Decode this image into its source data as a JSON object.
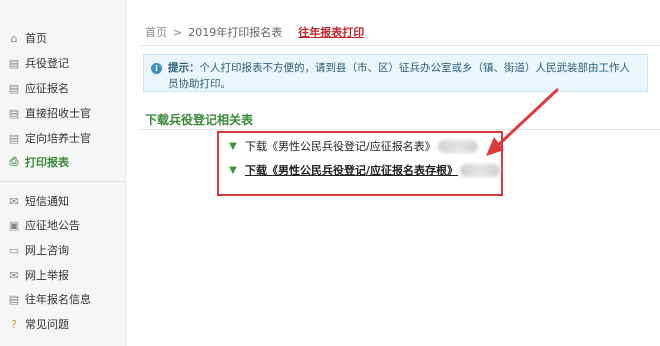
{
  "sidebar": {
    "items": [
      {
        "label": "首页",
        "icon": "home-icon"
      },
      {
        "label": "兵役登记",
        "icon": "document-icon"
      },
      {
        "label": "应征报名",
        "icon": "document-icon"
      },
      {
        "label": "直接招收士官",
        "icon": "document-icon"
      },
      {
        "label": "定向培养士官",
        "icon": "document-icon"
      },
      {
        "label": "打印报表",
        "icon": "printer-icon"
      }
    ],
    "items2": [
      {
        "label": "短信通知",
        "icon": "message-icon"
      },
      {
        "label": "应征地公告",
        "icon": "announcement-icon"
      },
      {
        "label": "网上咨询",
        "icon": "chat-icon"
      },
      {
        "label": "网上举报",
        "icon": "mail-icon"
      },
      {
        "label": "往年报名信息",
        "icon": "document-icon"
      },
      {
        "label": "常见问题",
        "icon": "question-icon"
      }
    ]
  },
  "breadcrumb": {
    "home": "首页",
    "separator": ">",
    "current": "2019年打印报名表",
    "link": "往年报表打印"
  },
  "notice": {
    "label": "提示：",
    "text": "个人打印报表不方便的，请到县（市、区）征兵办公室或乡（镇、街道）人民武装部由工作人员协助打印。"
  },
  "downloads": {
    "title": "下载兵役登记相关表",
    "items": [
      {
        "label": "下载《男性公民兵役登记/应征报名表》"
      },
      {
        "label": "下载《男性公民兵役登记/应征报名表存根》"
      }
    ]
  },
  "colors": {
    "accent_green": "#3a8a3a",
    "alert_red": "#d63a3a",
    "notice_bg": "#eaf6fb"
  }
}
